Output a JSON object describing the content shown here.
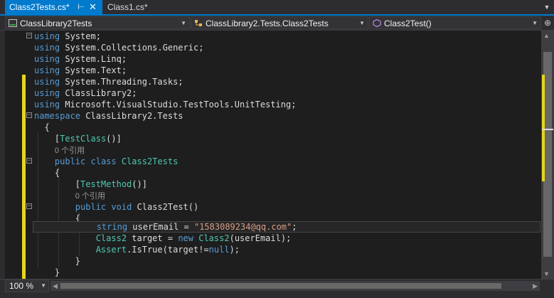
{
  "tabs": [
    {
      "label": "Class2Tests.cs*",
      "active": true
    },
    {
      "label": "Class1.cs*",
      "active": false
    }
  ],
  "navbar": {
    "project": "ClassLibrary2Tests",
    "class": "ClassLibrary2.Tests.Class2Tests",
    "member": "Class2Test()"
  },
  "zoom": "100 %",
  "code": {
    "l1_kw": "using",
    "l1_rest": " System;",
    "l2_kw": "using",
    "l2_rest": " System.Collections.Generic;",
    "l3_kw": "using",
    "l3_rest": " System.Linq;",
    "l4_kw": "using",
    "l4_rest": " System.Text;",
    "l5_kw": "using",
    "l5_rest": " System.Threading.Tasks;",
    "l6_kw": "using",
    "l6_rest": " ClassLibrary2;",
    "l7_kw": "using",
    "l7_rest": " Microsoft.VisualStudio.TestTools.UnitTesting;",
    "l8_kw": "namespace",
    "l8_rest": " ClassLibrary2.Tests",
    "l9": "{",
    "l10_open": "[",
    "l10_attr": "TestClass",
    "l10_close": "()]",
    "l11_lens": "0 个引用",
    "l12_kw1": "public",
    "l12_kw2": "class",
    "l12_type": "Class2Tests",
    "l13": "{",
    "l14_open": "[",
    "l14_attr": "TestMethod",
    "l14_close": "()]",
    "l15_lens": "0 个引用",
    "l16_kw1": "public",
    "l16_kw2": "void",
    "l16_rest": " Class2Test()",
    "l17": "{",
    "l18_kw": "string",
    "l18_mid": " userEmail = ",
    "l18_str": "\"1583089234@qq.com\"",
    "l18_end": ";",
    "l19_type1": "Class2",
    "l19_mid": " target = ",
    "l19_kw": "new",
    "l19_type2": "Class2",
    "l19_end": "(userEmail);",
    "l20_type": "Assert",
    "l20_mid": ".IsTrue(target!=",
    "l20_kw": "null",
    "l20_end": ");",
    "l21": "}",
    "l22": "}"
  }
}
